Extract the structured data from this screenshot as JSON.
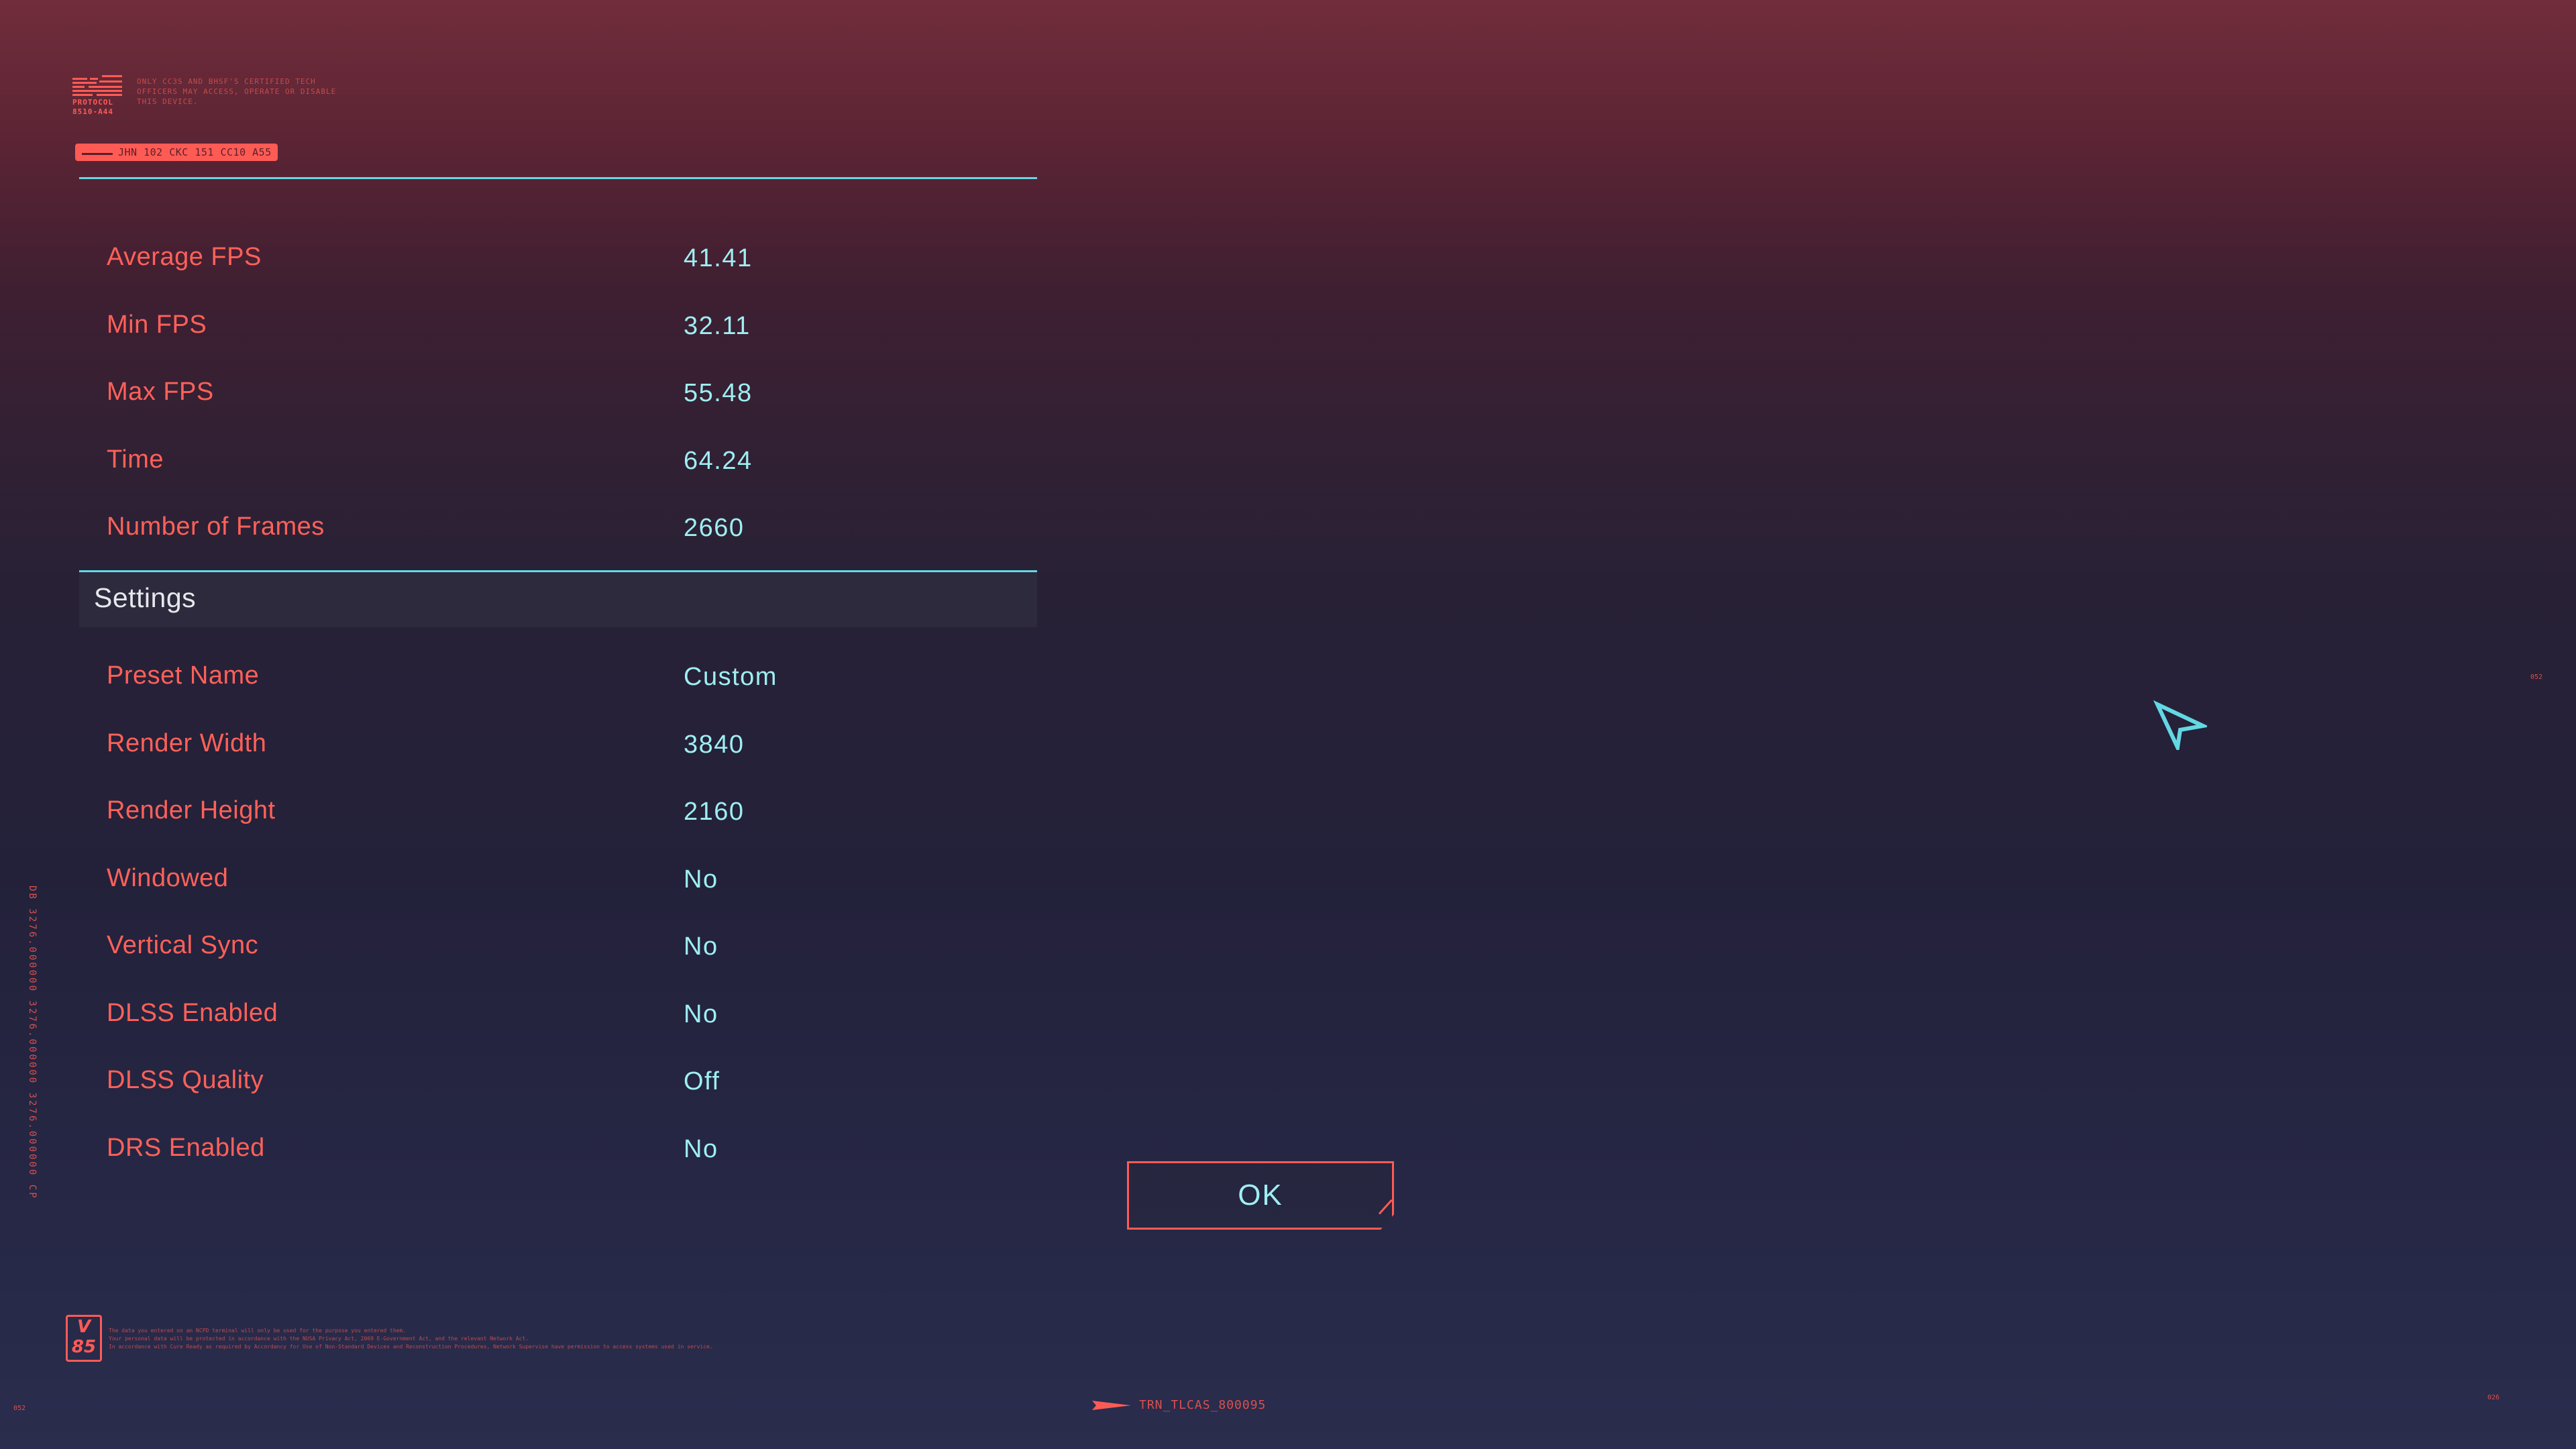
{
  "header": {
    "protocol_label": "PROTOCOL\n8510-A44",
    "protocol_notice": "ONLY CC3S AND BHSF'S CERTIFIED TECH OFFICERS MAY ACCESS, OPERATE OR DISABLE THIS DEVICE.",
    "code_tag": "JHN 102 CKC 151 CC10 A55"
  },
  "results": [
    {
      "label": "Average FPS",
      "value": "41.41"
    },
    {
      "label": "Min FPS",
      "value": "32.11"
    },
    {
      "label": "Max FPS",
      "value": "55.48"
    },
    {
      "label": "Time",
      "value": "64.24"
    },
    {
      "label": "Number of Frames",
      "value": "2660"
    }
  ],
  "settings": {
    "title": "Settings",
    "rows": [
      {
        "label": "Preset Name",
        "value": "Custom"
      },
      {
        "label": "Render Width",
        "value": "3840"
      },
      {
        "label": "Render Height",
        "value": "2160"
      },
      {
        "label": "Windowed",
        "value": "No"
      },
      {
        "label": "Vertical Sync",
        "value": "No"
      },
      {
        "label": "DLSS Enabled",
        "value": "No"
      },
      {
        "label": "DLSS Quality",
        "value": "Off"
      },
      {
        "label": "DRS Enabled",
        "value": "No"
      }
    ]
  },
  "ok_button": {
    "label": "OK"
  },
  "side_text": "DB 3276.000000 3276.000000 3276.000000 CP",
  "footer": {
    "badge_top": "V",
    "badge_bottom": "85",
    "legal_lines": [
      "The data you entered on an NCPD terminal will only be used for the purpose you entered them.",
      "Your personal data will be protected in accordance with the NUSA Privacy Act, 2069 E-Government Act, and the relevant Network Act.",
      "In accordance with Cure Ready as required by Accordancy for Use of Non-Standard Devices and Reconstruction Procedures, Network Supervise have permission to access systems used in service."
    ],
    "bottom_code": "TRN_TLCAS_800095",
    "corner_left": "052",
    "corner_right_mid": "052",
    "corner_right_bottom": "026"
  },
  "colors": {
    "accent_red": "#ff6159",
    "accent_cyan": "#63d8e4",
    "value_text": "#9eeef2",
    "header_text": "#e6e8ec"
  },
  "icons": {
    "cursor": "cursor-arrow-icon",
    "logo": "protocol-logo-icon",
    "arrow": "arrow-flag-icon"
  }
}
